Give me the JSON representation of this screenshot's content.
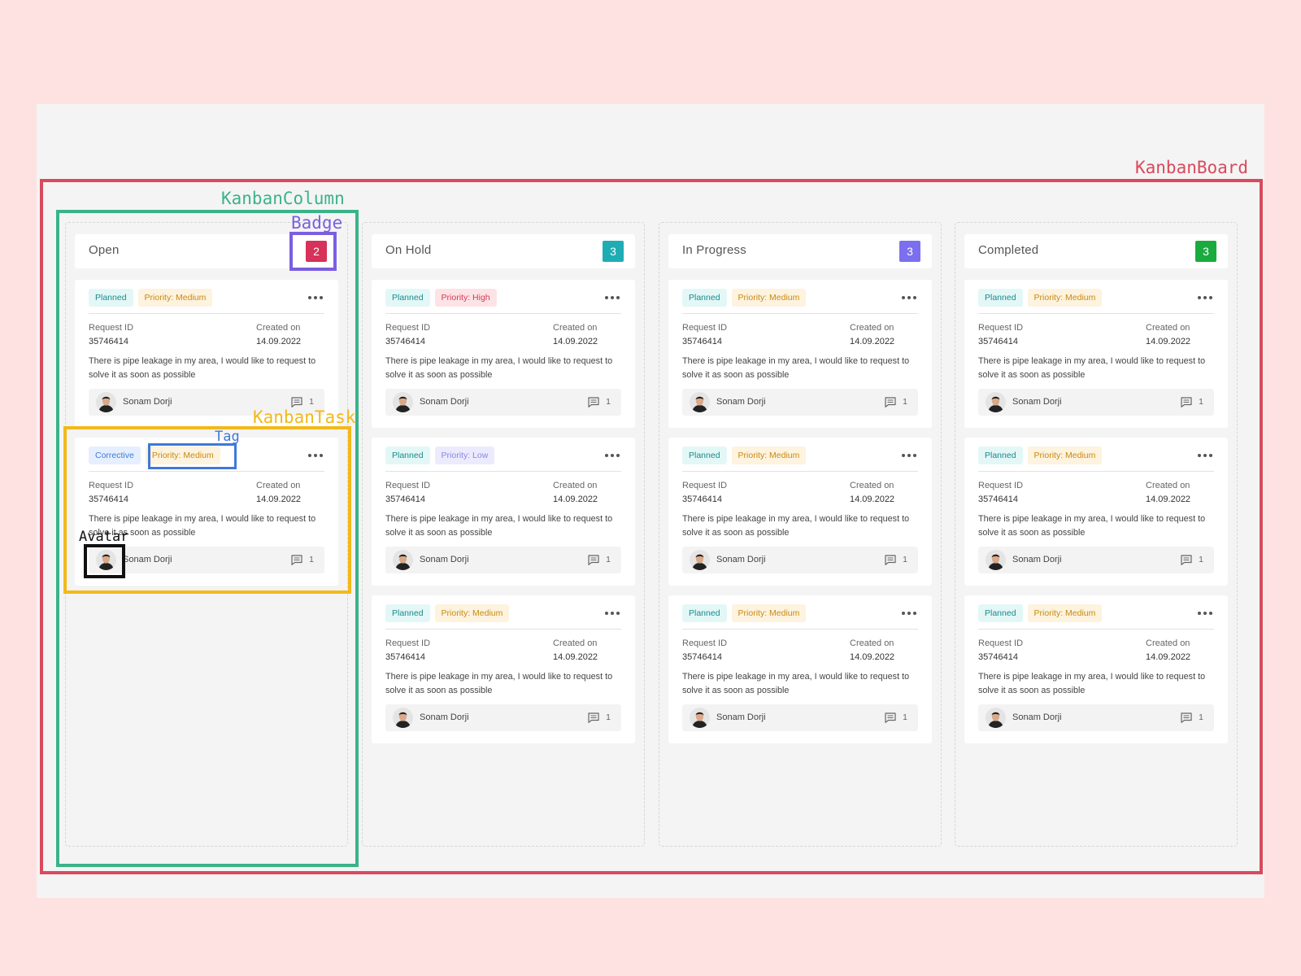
{
  "annotations": {
    "board": {
      "label": "KanbanBoard",
      "color": "#d94a5c"
    },
    "column": {
      "label": "KanbanColumn",
      "color": "#3ab389"
    },
    "badge": {
      "label": "Badge",
      "color": "#7a5fe0"
    },
    "task": {
      "label": "KanbanTask",
      "color": "#f2b91a"
    },
    "tag": {
      "label": "Tag",
      "color": "#3f78d8"
    },
    "avatar": {
      "label": "Avatar",
      "color": "#111111"
    }
  },
  "field_labels": {
    "request_id": "Request ID",
    "created_on": "Created on"
  },
  "columns": [
    {
      "title": "Open",
      "count": "2",
      "badge_color": "#d6325a",
      "cards": [
        {
          "tags": [
            {
              "label": "Planned",
              "kind": "planned"
            },
            {
              "label": "Priority: Medium",
              "kind": "p-medium"
            }
          ],
          "request_id": "35746414",
          "created_on": "14.09.2022",
          "description": "There is pipe leakage in my area, I would like to request to solve it as soon as possible",
          "assignee": "Sonam Dorji",
          "comments": "1"
        },
        {
          "tags": [
            {
              "label": "Corrective",
              "kind": "corrective"
            },
            {
              "label": "Priority: Medium",
              "kind": "p-medium"
            }
          ],
          "request_id": "35746414",
          "created_on": "14.09.2022",
          "description": "There is pipe leakage in my area, I would like to request to solve it as soon as possible",
          "assignee": "Sonam Dorji",
          "comments": "1"
        }
      ]
    },
    {
      "title": "On Hold",
      "count": "3",
      "badge_color": "#1fadb4",
      "cards": [
        {
          "tags": [
            {
              "label": "Planned",
              "kind": "planned"
            },
            {
              "label": "Priority: High",
              "kind": "p-high"
            }
          ],
          "request_id": "35746414",
          "created_on": "14.09.2022",
          "description": "There is pipe leakage in my area, I would like to request to solve it as soon as possible",
          "assignee": "Sonam Dorji",
          "comments": "1"
        },
        {
          "tags": [
            {
              "label": "Planned",
              "kind": "planned"
            },
            {
              "label": "Priority: Low",
              "kind": "p-low"
            }
          ],
          "request_id": "35746414",
          "created_on": "14.09.2022",
          "description": "There is pipe leakage in my area, I would like to request to solve it as soon as possible",
          "assignee": "Sonam Dorji",
          "comments": "1"
        },
        {
          "tags": [
            {
              "label": "Planned",
              "kind": "planned"
            },
            {
              "label": "Priority: Medium",
              "kind": "p-medium"
            }
          ],
          "request_id": "35746414",
          "created_on": "14.09.2022",
          "description": "There is pipe leakage in my area, I would like to request to solve it as soon as possible",
          "assignee": "Sonam Dorji",
          "comments": "1"
        }
      ]
    },
    {
      "title": "In Progress",
      "count": "3",
      "badge_color": "#7b6ff0",
      "cards": [
        {
          "tags": [
            {
              "label": "Planned",
              "kind": "planned"
            },
            {
              "label": "Priority: Medium",
              "kind": "p-medium"
            }
          ],
          "request_id": "35746414",
          "created_on": "14.09.2022",
          "description": "There is pipe leakage in my area, I would like to request to solve it as soon as possible",
          "assignee": "Sonam Dorji",
          "comments": "1"
        },
        {
          "tags": [
            {
              "label": "Planned",
              "kind": "planned"
            },
            {
              "label": "Priority: Medium",
              "kind": "p-medium"
            }
          ],
          "request_id": "35746414",
          "created_on": "14.09.2022",
          "description": "There is pipe leakage in my area, I would like to request to solve it as soon as possible",
          "assignee": "Sonam Dorji",
          "comments": "1"
        },
        {
          "tags": [
            {
              "label": "Planned",
              "kind": "planned"
            },
            {
              "label": "Priority: Medium",
              "kind": "p-medium"
            }
          ],
          "request_id": "35746414",
          "created_on": "14.09.2022",
          "description": "There is pipe leakage in my area, I would like to request to solve it as soon as possible",
          "assignee": "Sonam Dorji",
          "comments": "1"
        }
      ]
    },
    {
      "title": "Completed",
      "count": "3",
      "badge_color": "#1aab3f",
      "cards": [
        {
          "tags": [
            {
              "label": "Planned",
              "kind": "planned"
            },
            {
              "label": "Priority: Medium",
              "kind": "p-medium"
            }
          ],
          "request_id": "35746414",
          "created_on": "14.09.2022",
          "description": "There is pipe leakage in my area, I would like to request to solve it as soon as possible",
          "assignee": "Sonam Dorji",
          "comments": "1"
        },
        {
          "tags": [
            {
              "label": "Planned",
              "kind": "planned"
            },
            {
              "label": "Priority: Medium",
              "kind": "p-medium"
            }
          ],
          "request_id": "35746414",
          "created_on": "14.09.2022",
          "description": "There is pipe leakage in my area, I would like to request to solve it as soon as possible",
          "assignee": "Sonam Dorji",
          "comments": "1"
        },
        {
          "tags": [
            {
              "label": "Planned",
              "kind": "planned"
            },
            {
              "label": "Priority: Medium",
              "kind": "p-medium"
            }
          ],
          "request_id": "35746414",
          "created_on": "14.09.2022",
          "description": "There is pipe leakage in my area, I would like to request to solve it as soon as possible",
          "assignee": "Sonam Dorji",
          "comments": "1"
        }
      ]
    }
  ]
}
